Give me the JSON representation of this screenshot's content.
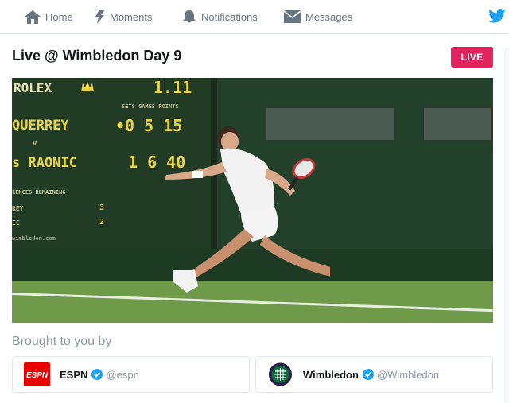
{
  "nav": {
    "items": [
      {
        "label": "Home",
        "icon": "home-icon"
      },
      {
        "label": "Moments",
        "icon": "lightning-icon"
      },
      {
        "label": "Notifications",
        "icon": "bell-icon"
      },
      {
        "label": "Messages",
        "icon": "envelope-icon"
      }
    ],
    "logo_icon": "twitter-bird-icon",
    "icon_color": "#66757f",
    "brand_color": "#1da1f2"
  },
  "event": {
    "title": "Live @ Wimbledon Day 9",
    "badge": "LIVE",
    "badge_color": "#e0245e"
  },
  "video": {
    "scoreboard": {
      "sponsor": "ROLEX",
      "clock": "1.11",
      "columns": "SETS GAMES POINTS",
      "player1": "QUERREY",
      "player1_score": "•0 5 15",
      "versus": "v",
      "player2": "s RAONIC",
      "player2_score": "1 6 40",
      "remaining_label": "LENGES REMAINING",
      "row1_label": "REY",
      "row1_value": "3",
      "row2_label": "IC",
      "row2_value": "2",
      "footer": "wimbledon.com"
    }
  },
  "sponsors": {
    "heading": "Brought to you by",
    "items": [
      {
        "name": "ESPN",
        "handle": "@espn",
        "logo_text": "ESPN",
        "logo_icon": "espn-logo-icon"
      },
      {
        "name": "Wimbledon",
        "handle": "@Wimbledon",
        "logo_icon": "wimbledon-logo-icon"
      }
    ],
    "verified_icon": "verified-badge-icon",
    "verified_color": "#1da1f2"
  }
}
